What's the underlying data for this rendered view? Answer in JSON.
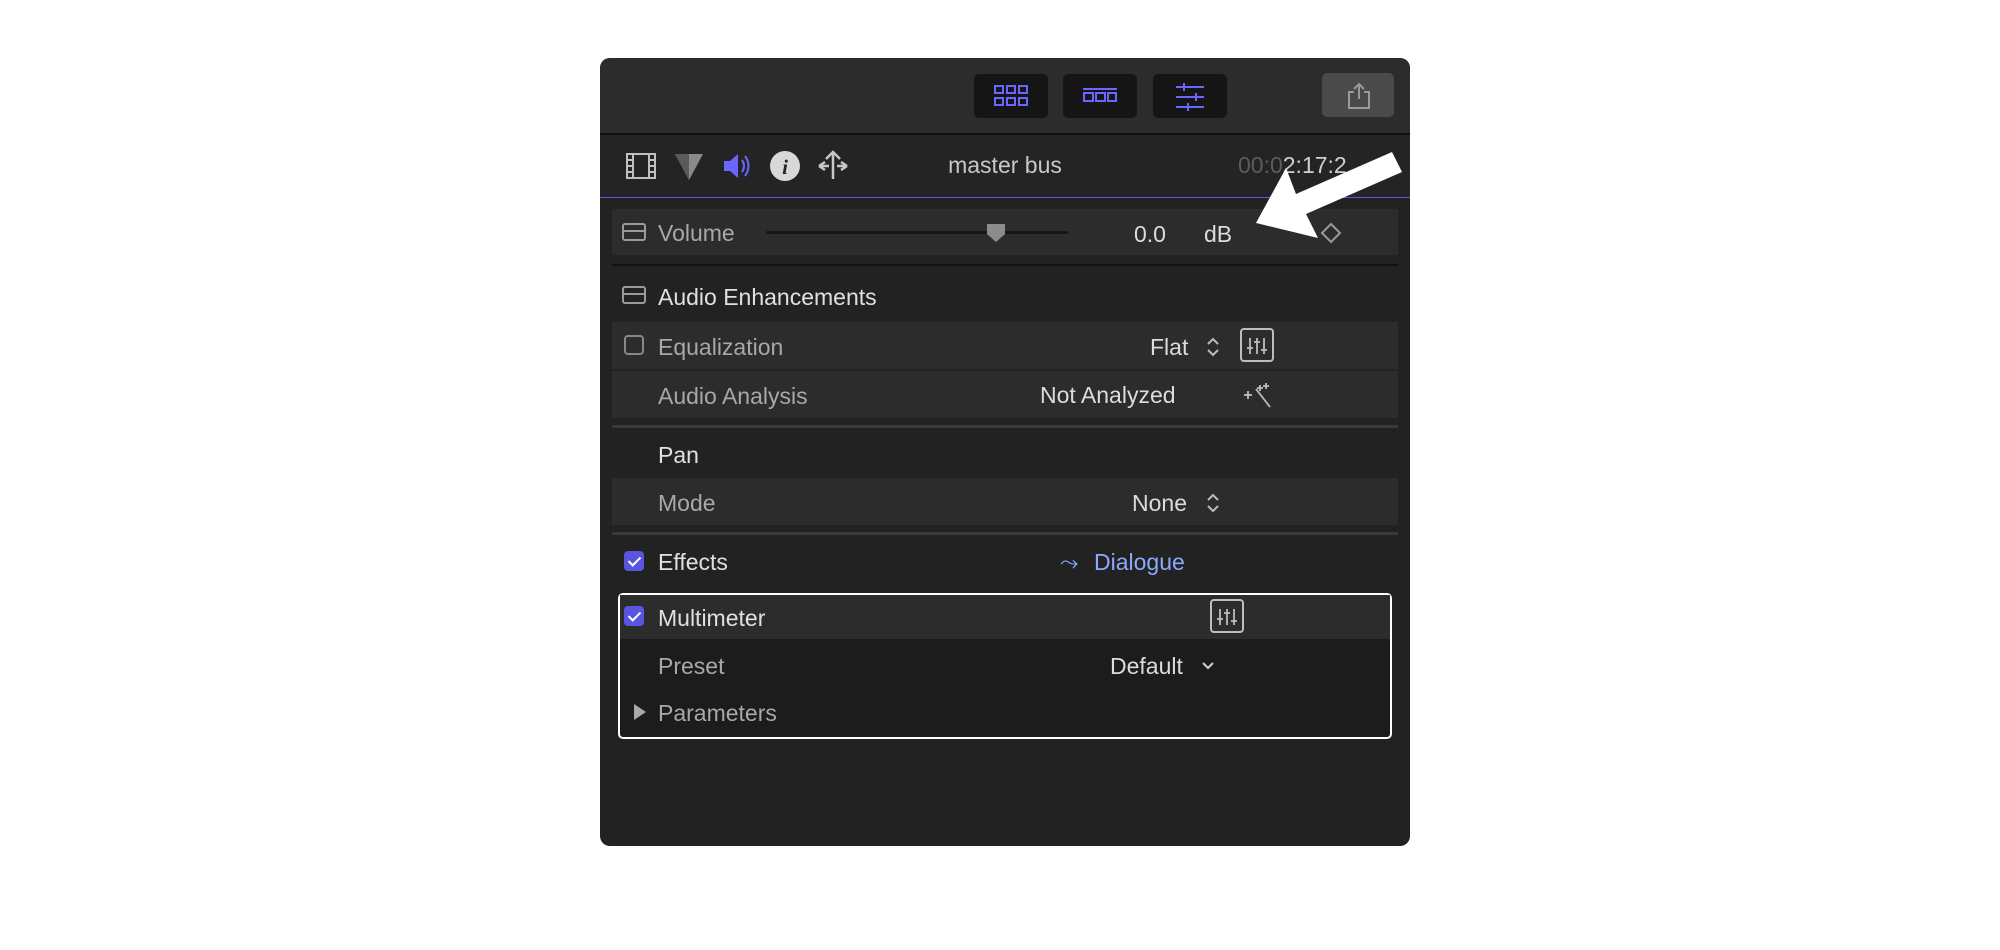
{
  "header": {
    "clip_name": "master bus",
    "timecode_dim": "00:0",
    "timecode_main": "2:17:2"
  },
  "volume": {
    "label": "Volume",
    "value": "0.0",
    "unit": "dB",
    "slider_fraction": 0.77
  },
  "audio_enhancements": {
    "title": "Audio Enhancements",
    "equalization": {
      "label": "Equalization",
      "value": "Flat",
      "enabled": false
    },
    "analysis": {
      "label": "Audio Analysis",
      "value": "Not Analyzed"
    }
  },
  "pan": {
    "title": "Pan",
    "mode_label": "Mode",
    "mode_value": "None"
  },
  "effects": {
    "title": "Effects",
    "enabled": true,
    "role_arrow": "⤳",
    "role": "Dialogue",
    "multimeter": {
      "label": "Multimeter",
      "enabled": true,
      "preset_label": "Preset",
      "preset_value": "Default",
      "parameters_label": "Parameters"
    }
  },
  "colors": {
    "accent": "#5a55e0",
    "role_text": "#8ea8ff",
    "panel_bg": "#222222"
  },
  "icons": [
    "grid-icon",
    "filmstrip-row-icon",
    "inspector-sliders-icon",
    "share-icon",
    "film-icon",
    "color-icon",
    "audio-speaker-icon",
    "info-icon",
    "transform-icon",
    "keyframe-icon",
    "eq-icon",
    "magic-wand-icon"
  ]
}
